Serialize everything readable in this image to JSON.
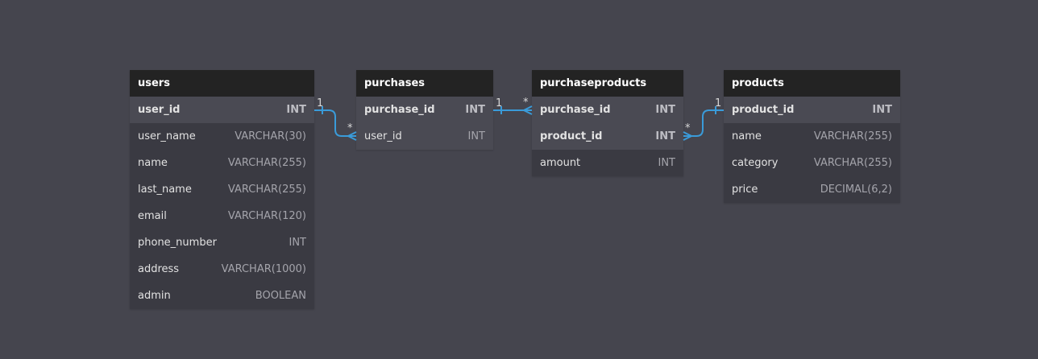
{
  "tables": {
    "users": {
      "name": "users",
      "columns": [
        {
          "name": "user_id",
          "type": "INT"
        },
        {
          "name": "user_name",
          "type": "VARCHAR(30)"
        },
        {
          "name": "name",
          "type": "VARCHAR(255)"
        },
        {
          "name": "last_name",
          "type": "VARCHAR(255)"
        },
        {
          "name": "email",
          "type": "VARCHAR(120)"
        },
        {
          "name": "phone_number",
          "type": "INT"
        },
        {
          "name": "address",
          "type": "VARCHAR(1000)"
        },
        {
          "name": "admin",
          "type": "BOOLEAN"
        }
      ]
    },
    "purchases": {
      "name": "purchases",
      "columns": [
        {
          "name": "purchase_id",
          "type": "INT"
        },
        {
          "name": "user_id",
          "type": "INT"
        }
      ]
    },
    "purchaseproducts": {
      "name": "purchaseproducts",
      "columns": [
        {
          "name": "purchase_id",
          "type": "INT"
        },
        {
          "name": "product_id",
          "type": "INT"
        },
        {
          "name": "amount",
          "type": "INT"
        }
      ]
    },
    "products": {
      "name": "products",
      "columns": [
        {
          "name": "product_id",
          "type": "INT"
        },
        {
          "name": "name",
          "type": "VARCHAR(255)"
        },
        {
          "name": "category",
          "type": "VARCHAR(255)"
        },
        {
          "name": "price",
          "type": "DECIMAL(6,2)"
        }
      ]
    }
  },
  "relations": [
    {
      "from_label": "1",
      "to_label": "*"
    },
    {
      "from_label": "1",
      "to_label": "*"
    },
    {
      "from_label": "*",
      "to_label": "1"
    }
  ],
  "colors": {
    "link": "#3a9bd9",
    "background": "#45454e",
    "header": "#232323"
  }
}
